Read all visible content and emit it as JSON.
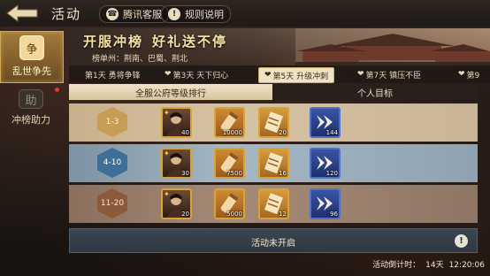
{
  "header": {
    "title": "活动",
    "customer_service_label": "腾讯客服",
    "rules_label": "规则说明"
  },
  "sidebar": {
    "items": [
      {
        "label": "乱世争先",
        "seal": "争"
      },
      {
        "label": "冲榜助力",
        "seal": "助"
      }
    ]
  },
  "banner": {
    "title_left": "开服冲榜",
    "title_right": "好礼送不停",
    "subtitle": "榜单州：荆南、巴蜀、荆北"
  },
  "day_tabs": [
    {
      "label": "第1天  勇将争锋",
      "heart": false
    },
    {
      "label": "第3天  天下归心",
      "heart": true
    },
    {
      "label": "第5天  升级冲刺",
      "heart": true,
      "active": true
    },
    {
      "label": "第7天  镇压不臣",
      "heart": true
    },
    {
      "label": "第9",
      "heart": true
    }
  ],
  "sub_tabs": {
    "left": "全服公府等级排行",
    "right": "个人目标"
  },
  "ranks": [
    {
      "rank": "1-3",
      "items": [
        {
          "type": "hero",
          "count": "40"
        },
        {
          "type": "scroll",
          "count": "10000"
        },
        {
          "type": "book",
          "count": "20"
        },
        {
          "type": "arrow",
          "count": "144"
        }
      ]
    },
    {
      "rank": "4-10",
      "items": [
        {
          "type": "hero",
          "count": "30"
        },
        {
          "type": "scroll",
          "count": "7500"
        },
        {
          "type": "book",
          "count": "16"
        },
        {
          "type": "arrow",
          "count": "120"
        }
      ]
    },
    {
      "rank": "11-20",
      "items": [
        {
          "type": "hero",
          "count": "20"
        },
        {
          "type": "scroll",
          "count": "5000"
        },
        {
          "type": "book",
          "count": "12"
        },
        {
          "type": "arrow",
          "count": "96"
        }
      ]
    }
  ],
  "status": {
    "text": "活动未开启",
    "info_icon": "!"
  },
  "countdown": {
    "label": "活动倒计时：",
    "days": "14天",
    "time": "12:20:06"
  }
}
